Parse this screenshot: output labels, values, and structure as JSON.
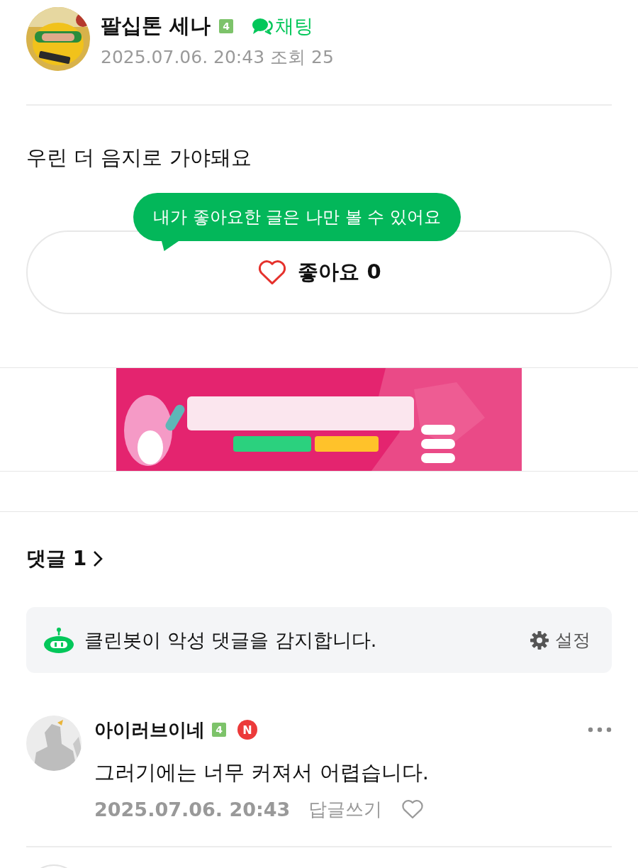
{
  "post": {
    "author": {
      "name": "팔십톤 세나",
      "level": "4"
    },
    "chat_link": "채팅",
    "date": "2025.07.06. 20:43",
    "views": "조회 25",
    "body": "우린 더 음지로 가야돼요",
    "tooltip": "내가 좋아요한 글은 나만 볼 수 있어요",
    "like": {
      "label": "좋아요",
      "count": "0",
      "liked": false
    }
  },
  "comments_header": {
    "label": "댓글",
    "count": "1"
  },
  "cleanbot": {
    "message": "클린봇이 악성 댓글을 감지합니다.",
    "settings": "설정"
  },
  "comments": [
    {
      "author": "아이러브이네",
      "level": "4",
      "badge": "N",
      "text": "그러기에는 너무 커져서 어렵습니다.",
      "date": "2025.07.06. 20:43",
      "reply": "답글쓰기",
      "liked": false
    }
  ]
}
